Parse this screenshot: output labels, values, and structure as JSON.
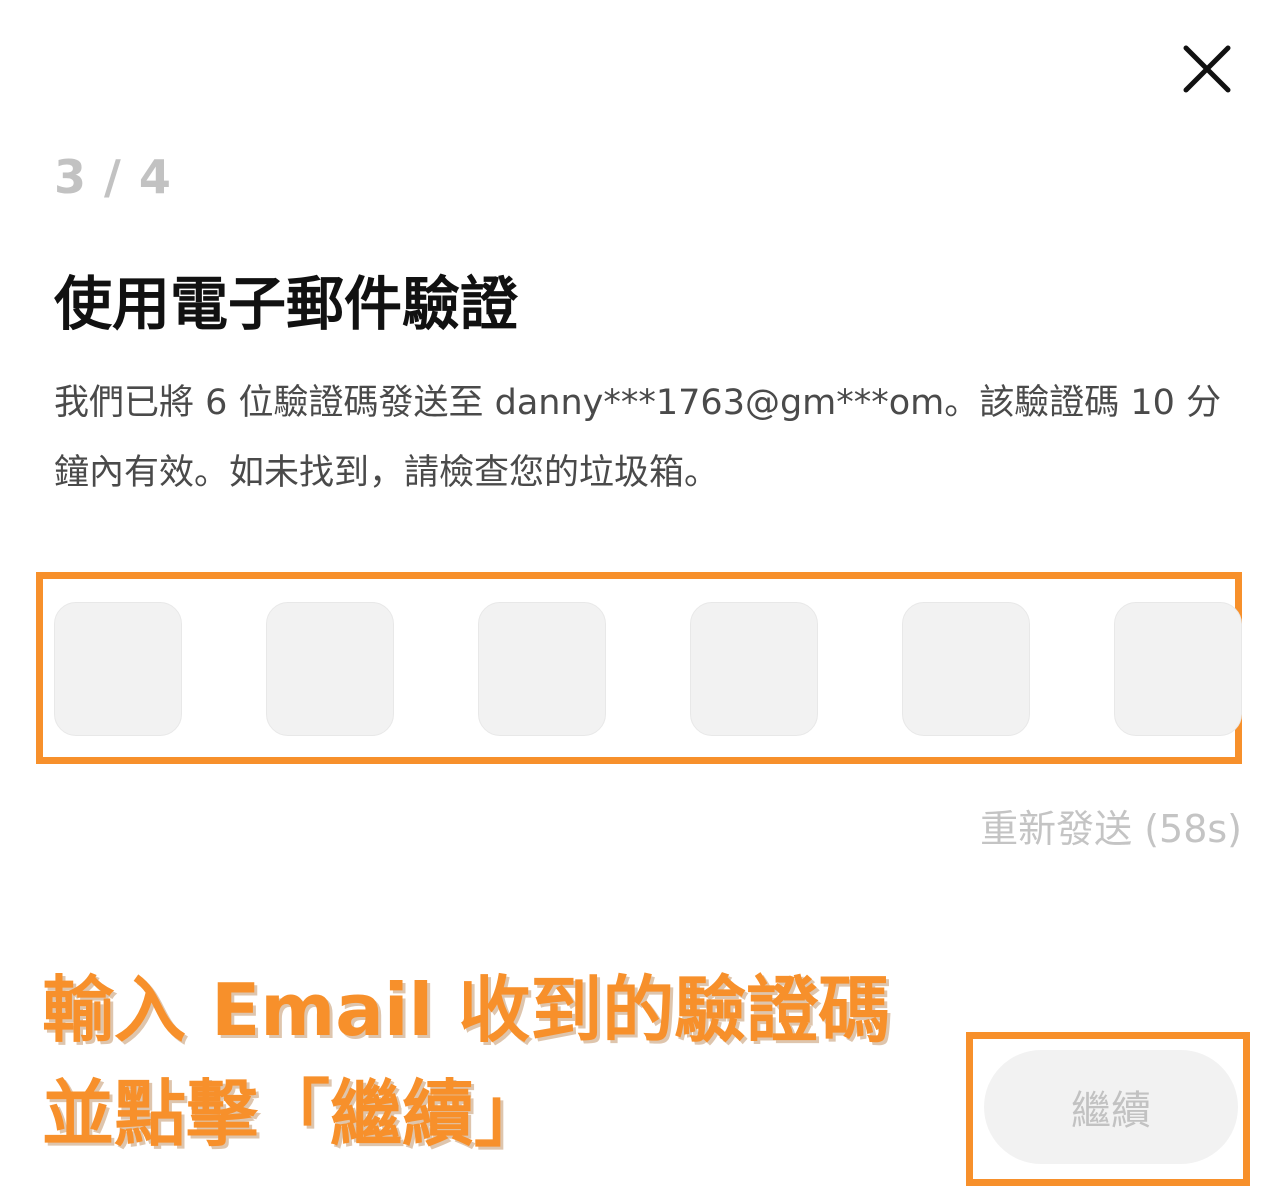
{
  "dialog": {
    "close_icon": "close-icon",
    "step": "3 / 4",
    "title": "使用電子郵件驗證",
    "description": "我們已將 6 位驗證碼發送至 danny***1763@gm***om。該驗證碼 10 分鐘內有效。如未找到，請檢查您的垃圾箱。"
  },
  "code_inputs": [
    "",
    "",
    "",
    "",
    "",
    ""
  ],
  "resend": {
    "label": "重新發送 (58s)"
  },
  "annotation": {
    "line1": "輸入 Email 收到的驗證碼",
    "line2": "並點擊「繼續」",
    "color": "#f7902b"
  },
  "continue_button": {
    "label": "繼續"
  }
}
